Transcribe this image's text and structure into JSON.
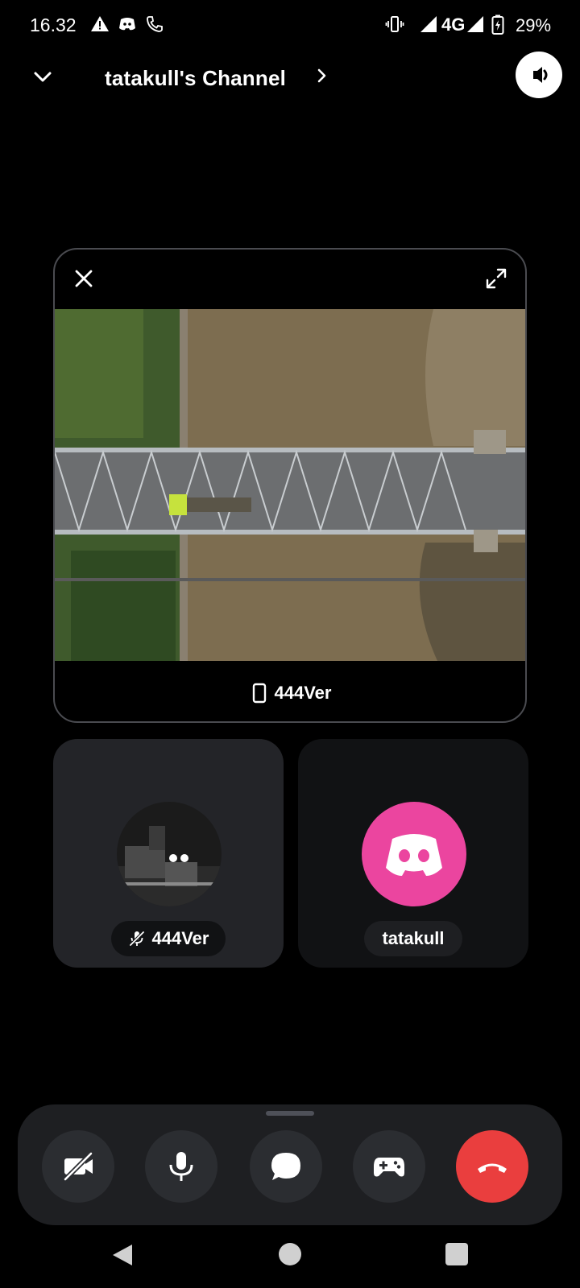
{
  "status_bar": {
    "time": "16.32",
    "network": "4G",
    "battery": "29%",
    "icons": [
      "alert-icon",
      "discord-icon",
      "phone-icon",
      "vibrate-icon",
      "signal-icon",
      "battery-charging-icon"
    ]
  },
  "header": {
    "title": "tatakull's Channel"
  },
  "stream": {
    "streamer_name": "444Ver"
  },
  "participants": [
    {
      "name": "444Ver",
      "muted": true
    },
    {
      "name": "tatakull",
      "muted": false,
      "avatar_color": "#eb459f"
    }
  ],
  "controls": {
    "buttons": [
      "camera-off-icon",
      "microphone-icon",
      "chat-icon",
      "gamepad-icon",
      "end-call-icon"
    ],
    "end_call_color": "#ea3e3e"
  },
  "colors": {
    "background": "#000000",
    "tile": "#232428",
    "discord_pink": "#eb459f"
  }
}
